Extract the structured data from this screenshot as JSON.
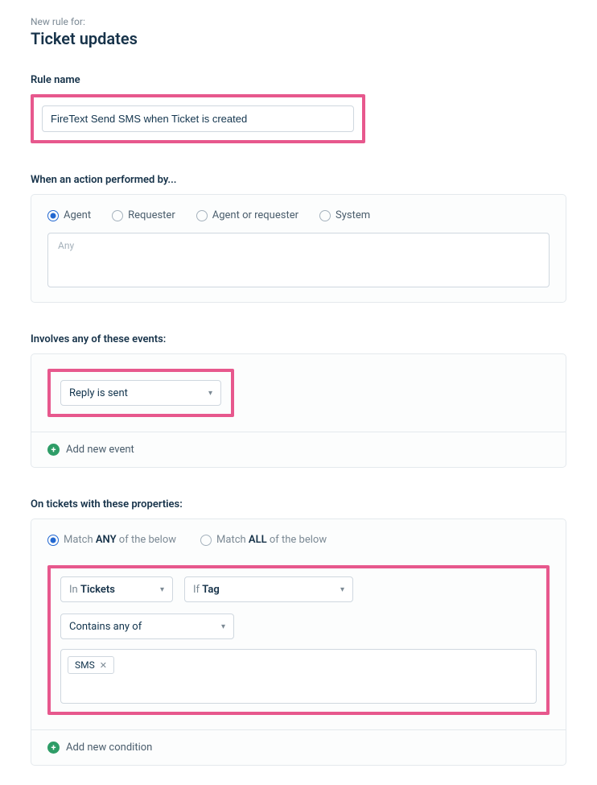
{
  "header": {
    "supertitle": "New rule for:",
    "title": "Ticket updates"
  },
  "ruleName": {
    "label": "Rule name",
    "value": "FireText Send SMS when Ticket is created"
  },
  "performedBy": {
    "label": "When an action performed by...",
    "options": {
      "agent": "Agent",
      "requester": "Requester",
      "agent_or_requester": "Agent or requester",
      "system": "System"
    },
    "anyPlaceholder": "Any"
  },
  "events": {
    "label": "Involves any of these events:",
    "selected": "Reply is sent",
    "addLabel": "Add new event"
  },
  "conditions": {
    "label": "On tickets with these properties:",
    "matchAny": {
      "prefix": "Match ",
      "bold": "ANY",
      "suffix": " of the below"
    },
    "matchAll": {
      "prefix": "Match ",
      "bold": "ALL",
      "suffix": " of the below"
    },
    "row": {
      "in": {
        "prefix": "In ",
        "value": "Tickets"
      },
      "if": {
        "prefix": "If ",
        "value": "Tag"
      },
      "operator": "Contains any of"
    },
    "tag": "SMS",
    "addLabel": "Add new condition"
  }
}
